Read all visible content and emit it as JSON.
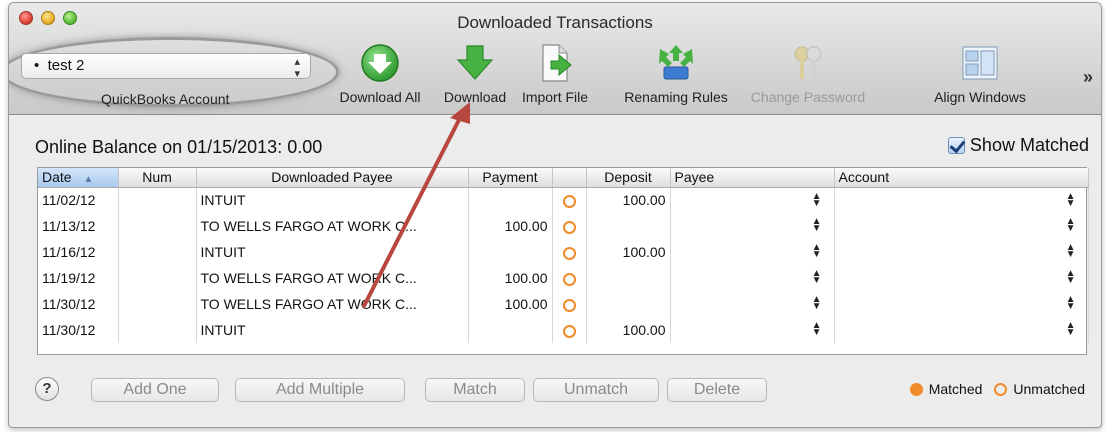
{
  "window": {
    "title": "Downloaded Transactions"
  },
  "account": {
    "selected": "test 2",
    "label": "QuickBooks Account"
  },
  "toolbar": {
    "download_all": "Download All",
    "download": "Download",
    "import_file": "Import File",
    "renaming_rules": "Renaming Rules",
    "change_password": "Change Password",
    "align_windows": "Align Windows",
    "more": "»"
  },
  "balance": "Online Balance on 01/15/2013: 0.00",
  "show_matched": {
    "label": "Show Matched",
    "checked": true
  },
  "table": {
    "columns": [
      "Date",
      "Num",
      "Downloaded Payee",
      "Payment",
      "",
      "Deposit",
      "Payee",
      "Account"
    ],
    "rows": [
      {
        "date": "11/02/12",
        "num": "",
        "payee": "INTUIT",
        "payment": "",
        "deposit": "100.00"
      },
      {
        "date": "11/13/12",
        "num": "",
        "payee": "TO WELLS FARGO AT WORK C...",
        "payment": "100.00",
        "deposit": ""
      },
      {
        "date": "11/16/12",
        "num": "",
        "payee": "INTUIT",
        "payment": "",
        "deposit": "100.00"
      },
      {
        "date": "11/19/12",
        "num": "",
        "payee": "TO WELLS FARGO AT WORK C...",
        "payment": "100.00",
        "deposit": ""
      },
      {
        "date": "11/30/12",
        "num": "",
        "payee": "TO WELLS FARGO AT WORK C...",
        "payment": "100.00",
        "deposit": ""
      },
      {
        "date": "11/30/12",
        "num": "",
        "payee": "INTUIT",
        "payment": "",
        "deposit": "100.00"
      }
    ]
  },
  "buttons": {
    "help": "?",
    "add_one": "Add One",
    "add_multiple": "Add Multiple",
    "match": "Match",
    "unmatch": "Unmatch",
    "delete": "Delete"
  },
  "legend": {
    "matched": "Matched",
    "unmatched": "Unmatched"
  },
  "colors": {
    "accent_orange": "#f08a2a",
    "arrow_red": "#b8473d",
    "download_green": "#3aa53a"
  }
}
